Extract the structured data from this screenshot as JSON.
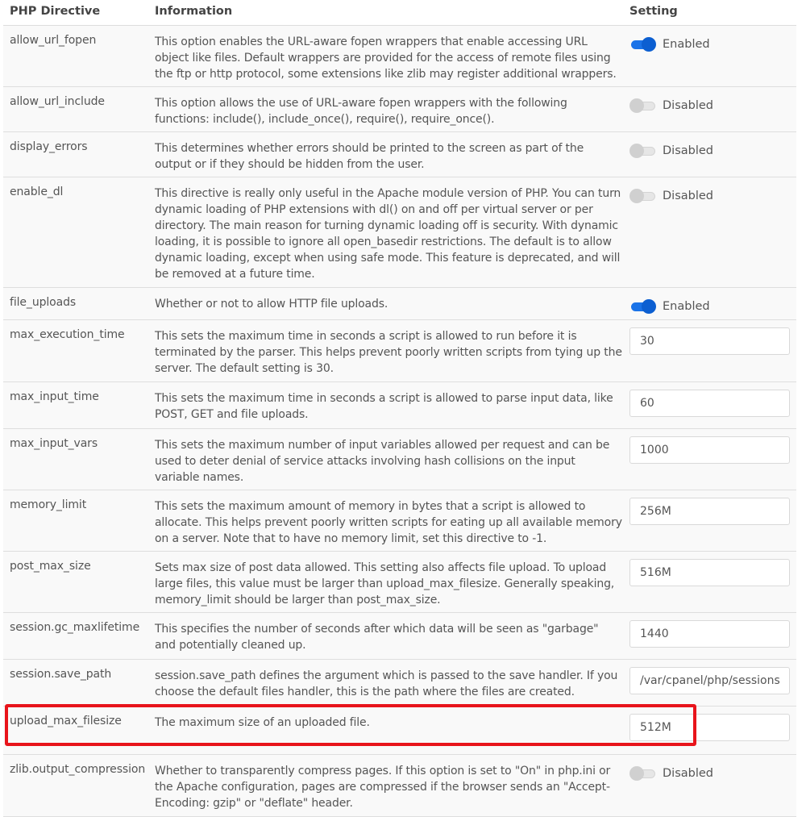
{
  "columns": {
    "directive": "PHP Directive",
    "information": "Information",
    "setting": "Setting"
  },
  "colors": {
    "toggle_on": "#1a73e8",
    "toggle_off": "#d0d0d0",
    "highlight": "#e8141b",
    "row_bg": "#f9f9f9"
  },
  "rows": [
    {
      "name": "allow_url_fopen",
      "info": "This option enables the URL-aware fopen wrappers that enable accessing URL object like files. Default wrappers are provided for the access of remote files using the ftp or http protocol, some extensions like zlib may register additional wrappers.",
      "type": "toggle",
      "state": "on",
      "label": "Enabled"
    },
    {
      "name": "allow_url_include",
      "info": "This option allows the use of URL-aware fopen wrappers with the following functions: include(), include_once(), require(), require_once().",
      "type": "toggle",
      "state": "off",
      "label": "Disabled"
    },
    {
      "name": "display_errors",
      "info": "This determines whether errors should be printed to the screen as part of the output or if they should be hidden from the user.",
      "type": "toggle",
      "state": "off",
      "label": "Disabled"
    },
    {
      "name": "enable_dl",
      "info": "This directive is really only useful in the Apache module version of PHP. You can turn dynamic loading of PHP extensions with dl() on and off per virtual server or per directory. The main reason for turning dynamic loading off is security. With dynamic loading, it is possible to ignore all open_basedir restrictions. The default is to allow dynamic loading, except when using safe mode. This feature is deprecated, and will be removed at a future time.",
      "type": "toggle",
      "state": "off",
      "label": "Disabled"
    },
    {
      "name": "file_uploads",
      "info": "Whether or not to allow HTTP file uploads.",
      "type": "toggle",
      "state": "on",
      "label": "Enabled"
    },
    {
      "name": "max_execution_time",
      "info": "This sets the maximum time in seconds a script is allowed to run before it is terminated by the parser. This helps prevent poorly written scripts from tying up the server. The default setting is 30.",
      "type": "input",
      "value": "30"
    },
    {
      "name": "max_input_time",
      "info": "This sets the maximum time in seconds a script is allowed to parse input data, like POST, GET and file uploads.",
      "type": "input",
      "value": "60"
    },
    {
      "name": "max_input_vars",
      "info": "This sets the maximum number of input variables allowed per request and can be used to deter denial of service attacks involving hash collisions on the input variable names.",
      "type": "input",
      "value": "1000"
    },
    {
      "name": "memory_limit",
      "info": "This sets the maximum amount of memory in bytes that a script is allowed to allocate. This helps prevent poorly written scripts for eating up all available memory on a server. Note that to have no memory limit, set this directive to -1.",
      "type": "input",
      "value": "256M"
    },
    {
      "name": "post_max_size",
      "info": "Sets max size of post data allowed. This setting also affects file upload. To upload large files, this value must be larger than upload_max_filesize. Generally speaking, memory_limit should be larger than post_max_size.",
      "type": "input",
      "value": "516M"
    },
    {
      "name": "session.gc_maxlifetime",
      "info": "This specifies the number of seconds after which data will be seen as \"garbage\" and potentially cleaned up.",
      "type": "input",
      "value": "1440"
    },
    {
      "name": "session.save_path",
      "info": "session.save_path defines the argument which is passed to the save handler. If you choose the default files handler, this is the path where the files are created.",
      "type": "input",
      "value": "/var/cpanel/php/sessions/"
    },
    {
      "name": "upload_max_filesize",
      "info": "The maximum size of an uploaded file.",
      "type": "input",
      "value": "512M",
      "highlighted": true
    },
    {
      "name": "zlib.output_compression",
      "info": "Whether to transparently compress pages. If this option is set to \"On\" in php.ini or the Apache configuration, pages are compressed if the browser sends an \"Accept-Encoding: gzip\" or \"deflate\" header.",
      "type": "toggle",
      "state": "off",
      "label": "Disabled"
    }
  ]
}
